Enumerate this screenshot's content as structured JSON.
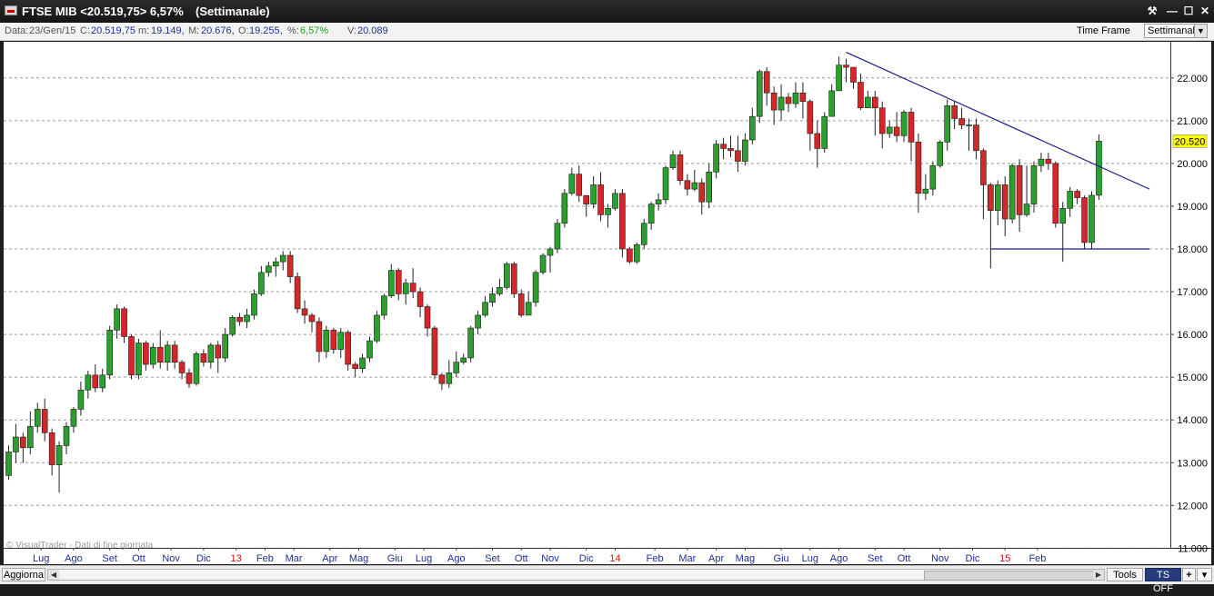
{
  "window": {
    "title_main": "FTSE MIB <20.519,75> 6,57%",
    "title_timeframe": "(Settimanale)",
    "controls": {
      "tool": "⚒",
      "minimize": "—",
      "maximize": "☐",
      "close": "✕"
    }
  },
  "infobar": {
    "data_label": "Data:",
    "data_value": "23/Gen/15",
    "c_label": "C:",
    "c_value": "20.519,75",
    "m_label": "m:",
    "m_value": "19.149,",
    "M_label": "M:",
    "M_value": "20.676,",
    "o_label": "O:",
    "o_value": "19.255,",
    "pct_label": "%:",
    "pct_value": "6,57%",
    "v_label": "V:",
    "v_value": "20.089",
    "timeframe_label": "Time Frame",
    "timeframe_value": "Settimanale"
  },
  "statusbar": {
    "refresh_label": "Aggiorna",
    "tools_label": "Tools",
    "ts_label": "TS OFF",
    "plus_label": "+",
    "menu_label": "▾"
  },
  "chart_data": {
    "type": "candlestick",
    "watermark": "© VisualTrader - Dati di fine giornata",
    "last_price_label": "20.520",
    "y_ticks": [
      "22.000",
      "21.000",
      "20.000",
      "19.000",
      "18.000",
      "17.000",
      "16.000",
      "15.000",
      "14.000",
      "13.000",
      "12.000",
      "11.000"
    ],
    "ylim": [
      11000,
      22700
    ],
    "grid": true,
    "x_labels": [
      {
        "t": "Lug",
        "i": 4.5,
        "red": false
      },
      {
        "t": "Ago",
        "i": 9,
        "red": false
      },
      {
        "t": "Set",
        "i": 14,
        "red": false
      },
      {
        "t": "Ott",
        "i": 18,
        "red": false
      },
      {
        "t": "Nov",
        "i": 22.5,
        "red": false
      },
      {
        "t": "Dic",
        "i": 27,
        "red": false
      },
      {
        "t": "13",
        "i": 31.5,
        "red": true
      },
      {
        "t": "Feb",
        "i": 35.5,
        "red": false
      },
      {
        "t": "Mar",
        "i": 39.5,
        "red": false
      },
      {
        "t": "Apr",
        "i": 44.5,
        "red": false
      },
      {
        "t": "Mag",
        "i": 48.5,
        "red": false
      },
      {
        "t": "Giu",
        "i": 53.5,
        "red": false
      },
      {
        "t": "Lug",
        "i": 57.5,
        "red": false
      },
      {
        "t": "Ago",
        "i": 62,
        "red": false
      },
      {
        "t": "Set",
        "i": 67,
        "red": false
      },
      {
        "t": "Ott",
        "i": 71,
        "red": false
      },
      {
        "t": "Nov",
        "i": 75,
        "red": false
      },
      {
        "t": "Dic",
        "i": 80,
        "red": false
      },
      {
        "t": "14",
        "i": 84,
        "red": true
      },
      {
        "t": "Feb",
        "i": 89.5,
        "red": false
      },
      {
        "t": "Mar",
        "i": 94,
        "red": false
      },
      {
        "t": "Apr",
        "i": 98,
        "red": false
      },
      {
        "t": "Mag",
        "i": 102,
        "red": false
      },
      {
        "t": "Giu",
        "i": 107,
        "red": false
      },
      {
        "t": "Lug",
        "i": 111,
        "red": false
      },
      {
        "t": "Ago",
        "i": 115,
        "red": false
      },
      {
        "t": "Set",
        "i": 120,
        "red": false
      },
      {
        "t": "Ott",
        "i": 124,
        "red": false
      },
      {
        "t": "Nov",
        "i": 129,
        "red": false
      },
      {
        "t": "Dic",
        "i": 133.5,
        "red": false
      },
      {
        "t": "15",
        "i": 138,
        "red": true
      },
      {
        "t": "Feb",
        "i": 142.5,
        "red": false
      }
    ],
    "candles": [
      [
        12700,
        13250,
        13400,
        12600
      ],
      [
        13250,
        13600,
        13900,
        13000
      ],
      [
        13600,
        13350,
        13700,
        13000
      ],
      [
        13350,
        13850,
        14200,
        13200
      ],
      [
        13850,
        14250,
        14400,
        13700
      ],
      [
        14250,
        13700,
        14500,
        13500
      ],
      [
        13700,
        12950,
        13800,
        12700
      ],
      [
        12950,
        13400,
        13500,
        12300
      ],
      [
        13400,
        13850,
        13950,
        13200
      ],
      [
        13850,
        14250,
        14300,
        13700
      ],
      [
        14250,
        14700,
        14900,
        14100
      ],
      [
        14700,
        15050,
        15150,
        14500
      ],
      [
        15050,
        14750,
        15300,
        14650
      ],
      [
        14750,
        15050,
        15200,
        14650
      ],
      [
        15050,
        16100,
        16200,
        14950
      ],
      [
        16100,
        16600,
        16700,
        15900
      ],
      [
        16600,
        15950,
        16650,
        15800
      ],
      [
        15950,
        15050,
        16000,
        14950
      ],
      [
        15050,
        15800,
        15900,
        14950
      ],
      [
        15800,
        15300,
        15850,
        15150
      ],
      [
        15300,
        15700,
        15800,
        15200
      ],
      [
        15700,
        15350,
        16100,
        15200
      ],
      [
        15350,
        15750,
        15850,
        15150
      ],
      [
        15750,
        15350,
        15850,
        15200
      ],
      [
        15350,
        15100,
        15400,
        14950
      ],
      [
        15100,
        14850,
        15200,
        14750
      ],
      [
        14850,
        15550,
        15600,
        14800
      ],
      [
        15550,
        15350,
        15650,
        15250
      ],
      [
        15350,
        15750,
        15800,
        15200
      ],
      [
        15750,
        15450,
        15850,
        15100
      ],
      [
        15450,
        16000,
        16150,
        15350
      ],
      [
        16000,
        16400,
        16450,
        15950
      ],
      [
        16400,
        16300,
        16500,
        16200
      ],
      [
        16300,
        16450,
        16600,
        16150
      ],
      [
        16450,
        16950,
        17050,
        16350
      ],
      [
        16950,
        17450,
        17600,
        16900
      ],
      [
        17450,
        17600,
        17700,
        17350
      ],
      [
        17600,
        17700,
        17800,
        17350
      ],
      [
        17700,
        17850,
        17950,
        17500
      ],
      [
        17850,
        17350,
        17950,
        17200
      ],
      [
        17350,
        16600,
        17450,
        16500
      ],
      [
        16600,
        16450,
        16800,
        16250
      ],
      [
        16450,
        16300,
        16500,
        16050
      ],
      [
        16300,
        15600,
        16400,
        15350
      ],
      [
        15600,
        16100,
        16200,
        15450
      ],
      [
        16100,
        15650,
        16150,
        15550
      ],
      [
        15650,
        16050,
        16150,
        15450
      ],
      [
        16050,
        15300,
        16100,
        15150
      ],
      [
        15300,
        15200,
        15350,
        15000
      ],
      [
        15200,
        15450,
        15550,
        15100
      ],
      [
        15450,
        15850,
        15950,
        15350
      ],
      [
        15850,
        16450,
        16550,
        15800
      ],
      [
        16450,
        16900,
        16950,
        16350
      ],
      [
        16900,
        17500,
        17650,
        16850
      ],
      [
        17500,
        16950,
        17550,
        16800
      ],
      [
        16950,
        17200,
        17300,
        16700
      ],
      [
        17200,
        17000,
        17550,
        16850
      ],
      [
        17000,
        16650,
        17100,
        16400
      ],
      [
        16650,
        16150,
        16700,
        15950
      ],
      [
        16150,
        15050,
        16200,
        14950
      ],
      [
        15050,
        14850,
        15100,
        14700
      ],
      [
        14850,
        15100,
        15400,
        14750
      ],
      [
        15100,
        15350,
        15600,
        15000
      ],
      [
        15350,
        15450,
        15550,
        15300
      ],
      [
        15450,
        16150,
        16200,
        15350
      ],
      [
        16150,
        16450,
        16550,
        16000
      ],
      [
        16450,
        16750,
        16900,
        16400
      ],
      [
        16750,
        16950,
        17100,
        16650
      ],
      [
        16950,
        17100,
        17300,
        16900
      ],
      [
        17100,
        17650,
        17700,
        17050
      ],
      [
        17650,
        16950,
        17700,
        16850
      ],
      [
        16950,
        16450,
        17050,
        16400
      ],
      [
        16450,
        16750,
        17000,
        16600
      ],
      [
        16750,
        17450,
        17500,
        16650
      ],
      [
        17450,
        17850,
        17900,
        17400
      ],
      [
        17850,
        18000,
        18050,
        17450
      ],
      [
        18000,
        18600,
        18700,
        17900
      ],
      [
        18600,
        19300,
        19400,
        18500
      ],
      [
        19300,
        19750,
        19900,
        19250
      ],
      [
        19750,
        19250,
        19950,
        19100
      ],
      [
        19250,
        19050,
        19250,
        18750
      ],
      [
        19050,
        19500,
        19700,
        18950
      ],
      [
        19500,
        18800,
        19800,
        18650
      ],
      [
        18800,
        18950,
        19050,
        18500
      ],
      [
        18950,
        19300,
        19400,
        18900
      ],
      [
        19300,
        18000,
        19400,
        17800
      ],
      [
        18000,
        17700,
        18050,
        17650
      ],
      [
        17700,
        18100,
        18150,
        17650
      ],
      [
        18100,
        18600,
        18700,
        18000
      ],
      [
        18600,
        19050,
        19100,
        18450
      ],
      [
        19050,
        19150,
        19300,
        18900
      ],
      [
        19150,
        19900,
        19950,
        19050
      ],
      [
        19900,
        20200,
        20300,
        19850
      ],
      [
        20200,
        19600,
        20300,
        19500
      ],
      [
        19600,
        19400,
        19750,
        19250
      ],
      [
        19400,
        19550,
        19850,
        19350
      ],
      [
        19550,
        19100,
        19650,
        18800
      ],
      [
        19100,
        19800,
        20000,
        18950
      ],
      [
        19800,
        20450,
        20550,
        19650
      ],
      [
        20450,
        20350,
        20600,
        20100
      ],
      [
        20350,
        20300,
        20650,
        20150
      ],
      [
        20300,
        20050,
        20650,
        19800
      ],
      [
        20050,
        20550,
        20700,
        19950
      ],
      [
        20550,
        21100,
        21300,
        20450
      ],
      [
        21100,
        22150,
        22200,
        20950
      ],
      [
        22150,
        21650,
        22250,
        21350
      ],
      [
        21650,
        21250,
        21800,
        20900
      ],
      [
        21250,
        21550,
        21850,
        21000
      ],
      [
        21550,
        21400,
        21650,
        21200
      ],
      [
        21400,
        21650,
        21900,
        21300
      ],
      [
        21650,
        21450,
        21900,
        21050
      ],
      [
        21450,
        20700,
        21500,
        20300
      ],
      [
        20700,
        20350,
        21000,
        19900
      ],
      [
        20350,
        21100,
        21200,
        20250
      ],
      [
        21100,
        21700,
        21850,
        21100
      ],
      [
        21700,
        22300,
        22500,
        22000
      ],
      [
        22300,
        22250,
        22450,
        21900
      ],
      [
        22250,
        21900,
        22150,
        21750
      ],
      [
        21900,
        21300,
        22100,
        21250
      ],
      [
        21300,
        21550,
        21700,
        21350
      ],
      [
        21550,
        21300,
        21700,
        20650
      ],
      [
        21300,
        20700,
        21450,
        20350
      ],
      [
        20700,
        20850,
        21000,
        20600
      ],
      [
        20850,
        20650,
        21200,
        20500
      ],
      [
        20650,
        21200,
        21250,
        20500
      ],
      [
        21200,
        20500,
        21300,
        20050
      ],
      [
        20500,
        19300,
        20700,
        18850
      ],
      [
        19300,
        19400,
        19750,
        19150
      ],
      [
        19400,
        19950,
        20050,
        19250
      ],
      [
        19950,
        20500,
        20550,
        19900
      ],
      [
        20500,
        21350,
        21500,
        20300
      ],
      [
        21350,
        21050,
        21450,
        20800
      ],
      [
        21050,
        20900,
        21300,
        20800
      ],
      [
        20900,
        20900,
        21050,
        20300
      ],
      [
        20900,
        20300,
        21050,
        20100
      ],
      [
        20300,
        19500,
        20350,
        18700
      ],
      [
        19500,
        18900,
        19550,
        17550
      ],
      [
        18900,
        19500,
        19600,
        18550
      ],
      [
        19500,
        18700,
        19700,
        18300
      ],
      [
        18700,
        19950,
        20000,
        18600
      ],
      [
        19950,
        18800,
        20100,
        18400
      ],
      [
        18800,
        19050,
        19950,
        18750
      ],
      [
        19050,
        19950,
        20050,
        18850
      ],
      [
        19950,
        20100,
        20250,
        19800
      ],
      [
        20100,
        20000,
        20250,
        19850
      ],
      [
        20000,
        18600,
        20050,
        18500
      ],
      [
        18600,
        18950,
        19100,
        17700
      ],
      [
        18950,
        19350,
        19450,
        18750
      ],
      [
        19350,
        19200,
        19400,
        19050
      ],
      [
        19200,
        18150,
        19250,
        18000
      ],
      [
        18150,
        19255,
        19350,
        18000
      ],
      [
        19255,
        20520,
        20676,
        19149
      ]
    ],
    "trendlines": [
      {
        "from": [
          116,
          22600
        ],
        "to": [
          158,
          19400
        ],
        "color": "#1a1a8c"
      },
      {
        "from": [
          136,
          18000
        ],
        "to": [
          158,
          18000
        ],
        "color": "#1a1a8c"
      }
    ]
  }
}
